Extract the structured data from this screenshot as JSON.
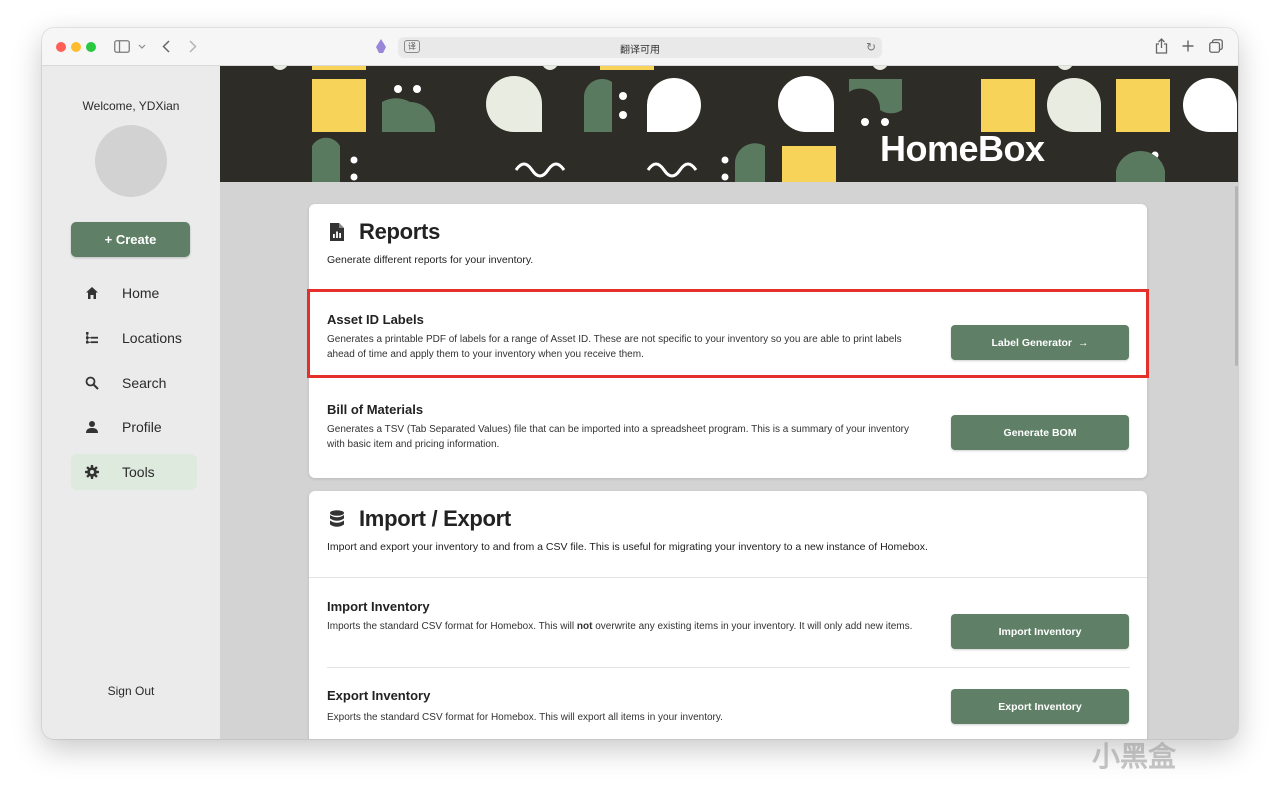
{
  "browser": {
    "address_text": "翻译可用",
    "translate_badge": "译"
  },
  "sidebar": {
    "welcome": "Welcome, YDXian",
    "create_label": "+ Create",
    "items": [
      {
        "label": "Home",
        "icon": "home-icon"
      },
      {
        "label": "Locations",
        "icon": "tree-icon"
      },
      {
        "label": "Search",
        "icon": "search-icon"
      },
      {
        "label": "Profile",
        "icon": "user-icon"
      },
      {
        "label": "Tools",
        "icon": "gear-icon",
        "active": true
      }
    ],
    "sign_out": "Sign Out"
  },
  "hero": {
    "logo": "HomeBox"
  },
  "reports": {
    "title": "Reports",
    "description": "Generate different reports for your inventory.",
    "rows": [
      {
        "title": "Asset ID Labels",
        "description": "Generates a printable PDF of labels for a range of Asset ID. These are not specific to your inventory so you are able to print labels ahead of time and apply them to your inventory when you receive them.",
        "button": "Label Generator",
        "highlighted": true
      },
      {
        "title": "Bill of Materials",
        "description": "Generates a TSV (Tab Separated Values) file that can be imported into a spreadsheet program. This is a summary of your inventory with basic item and pricing information.",
        "button": "Generate BOM"
      }
    ]
  },
  "import_export": {
    "title": "Import / Export",
    "description": "Import and export your inventory to and from a CSV file. This is useful for migrating your inventory to a new instance of Homebox.",
    "rows": [
      {
        "title": "Import Inventory",
        "description_pre": "Imports the standard CSV format for Homebox. This will ",
        "description_bold": "not",
        "description_post": " overwrite any existing items in your inventory. It will only add new items.",
        "button": "Import Inventory"
      },
      {
        "title": "Export Inventory",
        "description": "Exports the standard CSV format for Homebox. This will export all items in your inventory.",
        "button": "Export Inventory"
      }
    ]
  },
  "watermark": "小黑盒",
  "colors": {
    "accent": "#5f7f66",
    "hero_bg": "#2e2c27",
    "highlight": "#e52f2a",
    "active_nav": "#dfeadf"
  }
}
